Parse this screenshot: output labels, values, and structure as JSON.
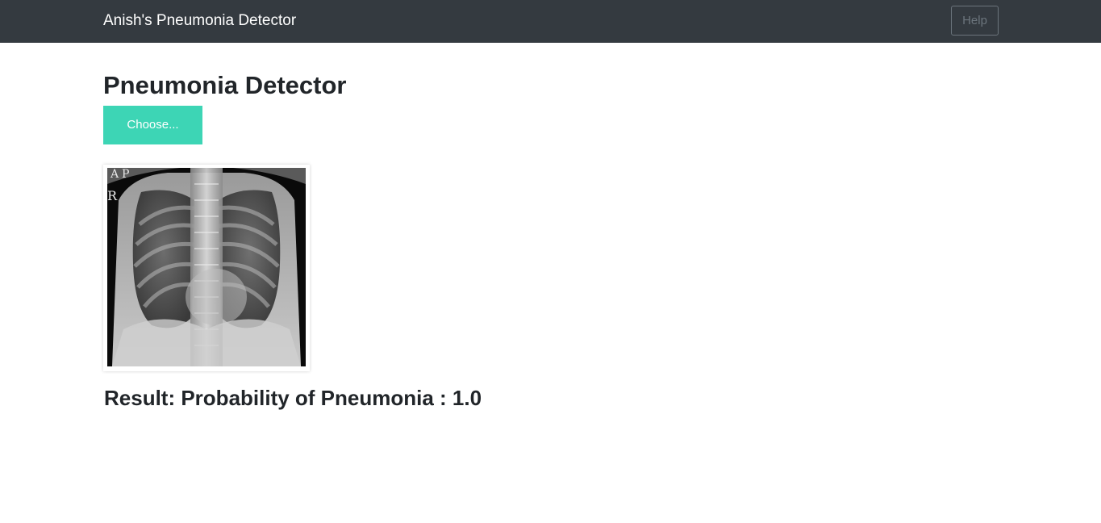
{
  "navbar": {
    "brand": "Anish's Pneumonia Detector",
    "help_label": "Help"
  },
  "main": {
    "title": "Pneumonia Detector",
    "choose_label": "Choose...",
    "xray_markers": [
      "A",
      "P",
      "R"
    ],
    "result_text": "Result: Probability of Pneumonia : 1.0"
  },
  "colors": {
    "navbar_bg": "#343a40",
    "choose_button": "#3dd5b5",
    "help_border": "#6c757d"
  }
}
